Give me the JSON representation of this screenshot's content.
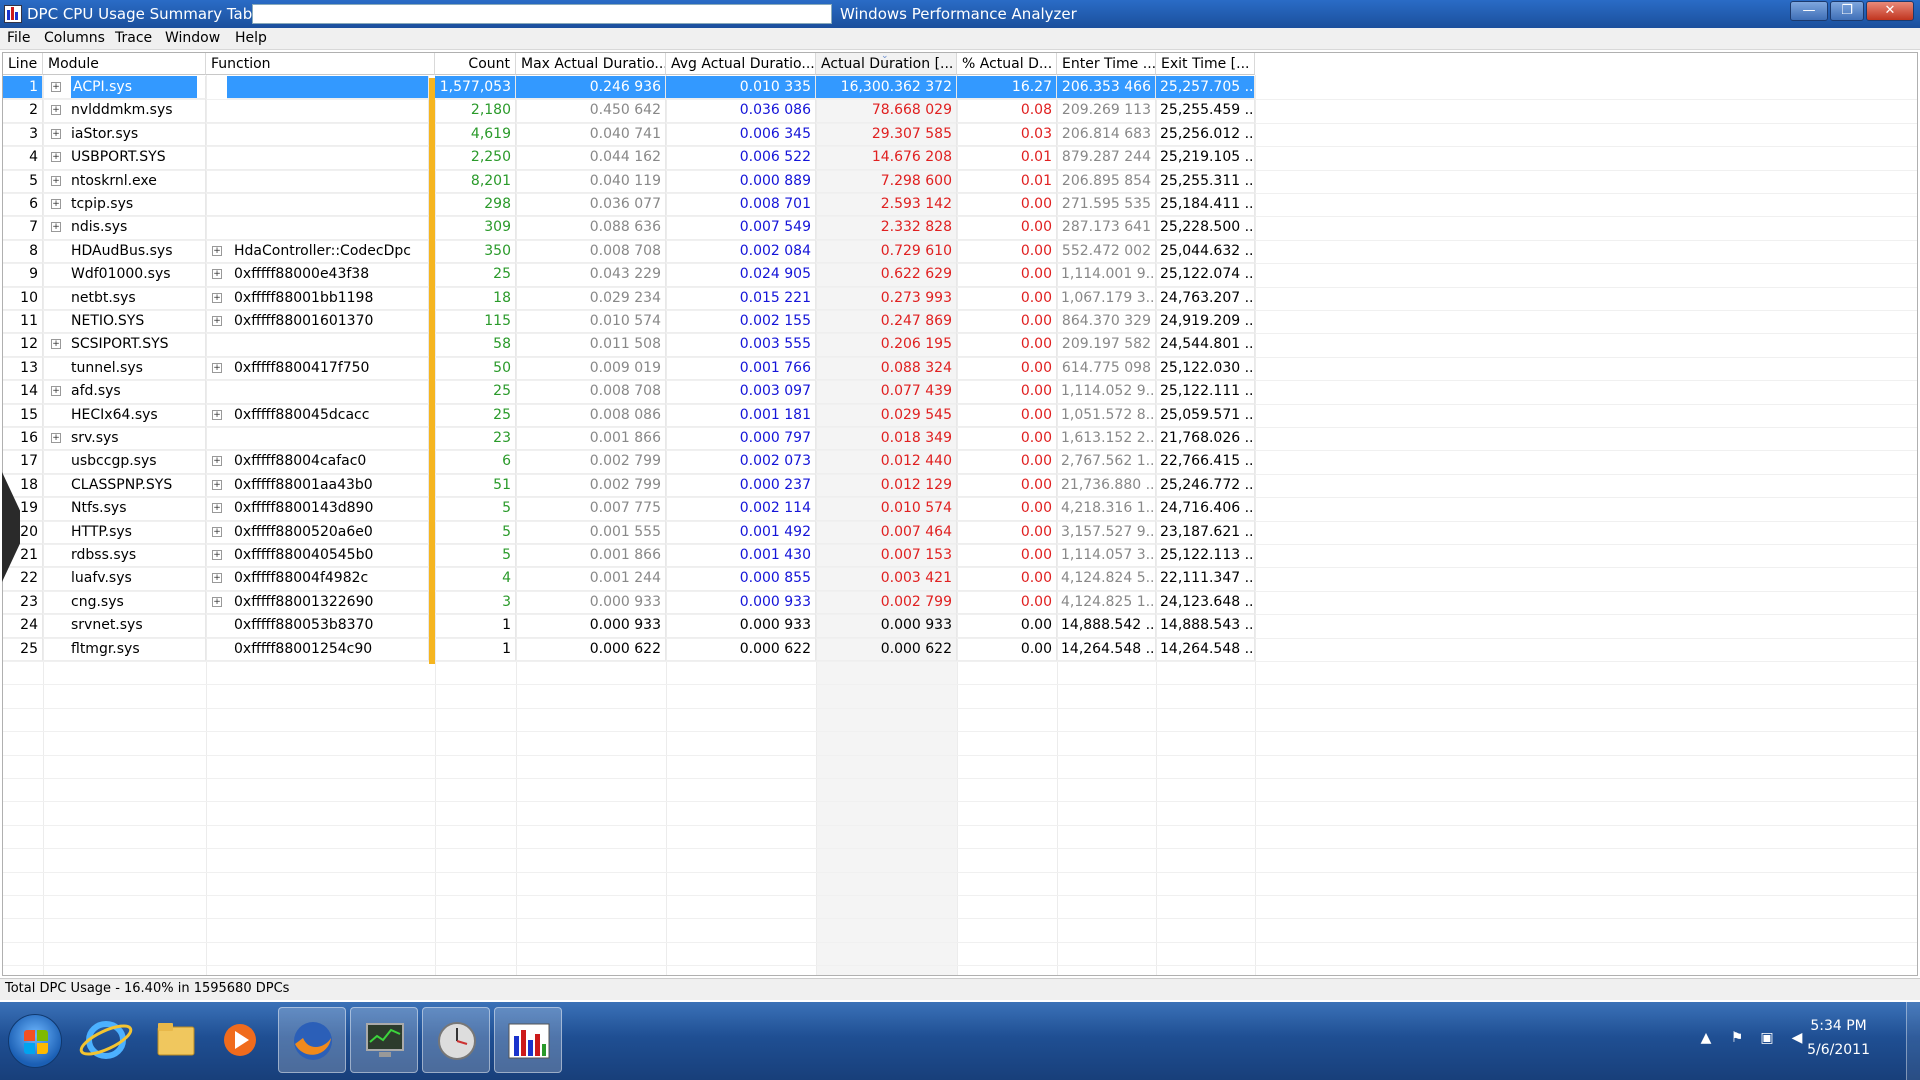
{
  "window": {
    "title": "DPC CPU Usage Summary Table -",
    "app_name": "Windows Performance Analyzer",
    "controls": {
      "minimize": "—",
      "maximize": "❐",
      "close": "✕"
    }
  },
  "menu": [
    "File",
    "Columns",
    "Trace",
    "Window",
    "Help"
  ],
  "columns": {
    "line": "Line",
    "module": "Module",
    "function": "Function",
    "count": "Count",
    "max_dur": "Max Actual Duratio...",
    "avg_dur": "Avg Actual Duratio...",
    "act_dur": "Actual Duration [...",
    "pct": "% Actual D...",
    "enter": "Enter Time ...",
    "exit": "Exit Time [..."
  },
  "rows": [
    {
      "line": "1",
      "module": "ACPI.sys",
      "function": "",
      "count": "1,577,053",
      "max": "0.246 936",
      "avg": "0.010 335",
      "act": "16,300.362 372",
      "pct": "16.27",
      "enter": "206.353 466",
      "exit": "25,257.705 ...",
      "expand": "module",
      "selected": true
    },
    {
      "line": "2",
      "module": "nvlddmkm.sys",
      "function": "",
      "count": "2,180",
      "max": "0.450 642",
      "avg": "0.036 086",
      "act": "78.668 029",
      "pct": "0.08",
      "enter": "209.269 113",
      "exit": "25,255.459 ...",
      "expand": "module"
    },
    {
      "line": "3",
      "module": "iaStor.sys",
      "function": "",
      "count": "4,619",
      "max": "0.040 741",
      "avg": "0.006 345",
      "act": "29.307 585",
      "pct": "0.03",
      "enter": "206.814 683",
      "exit": "25,256.012 ...",
      "expand": "module"
    },
    {
      "line": "4",
      "module": "USBPORT.SYS",
      "function": "",
      "count": "2,250",
      "max": "0.044 162",
      "avg": "0.006 522",
      "act": "14.676 208",
      "pct": "0.01",
      "enter": "879.287 244",
      "exit": "25,219.105 ...",
      "expand": "module"
    },
    {
      "line": "5",
      "module": "ntoskrnl.exe",
      "function": "",
      "count": "8,201",
      "max": "0.040 119",
      "avg": "0.000 889",
      "act": "7.298 600",
      "pct": "0.01",
      "enter": "206.895 854",
      "exit": "25,255.311 ...",
      "expand": "module"
    },
    {
      "line": "6",
      "module": "tcpip.sys",
      "function": "",
      "count": "298",
      "max": "0.036 077",
      "avg": "0.008 701",
      "act": "2.593 142",
      "pct": "0.00",
      "enter": "271.595 535",
      "exit": "25,184.411 ...",
      "expand": "module"
    },
    {
      "line": "7",
      "module": "ndis.sys",
      "function": "",
      "count": "309",
      "max": "0.088 636",
      "avg": "0.007 549",
      "act": "2.332 828",
      "pct": "0.00",
      "enter": "287.173 641",
      "exit": "25,228.500 ...",
      "expand": "module"
    },
    {
      "line": "8",
      "module": "HDAudBus.sys",
      "function": "HdaController::CodecDpc",
      "count": "350",
      "max": "0.008 708",
      "avg": "0.002 084",
      "act": "0.729 610",
      "pct": "0.00",
      "enter": "552.472 002",
      "exit": "25,044.632 ...",
      "expand": "function"
    },
    {
      "line": "9",
      "module": "Wdf01000.sys",
      "function": "0xfffff88000e43f38",
      "count": "25",
      "max": "0.043 229",
      "avg": "0.024 905",
      "act": "0.622 629",
      "pct": "0.00",
      "enter": "1,114.001 9...",
      "exit": "25,122.074 ...",
      "expand": "function"
    },
    {
      "line": "10",
      "module": "netbt.sys",
      "function": "0xfffff88001bb1198",
      "count": "18",
      "max": "0.029 234",
      "avg": "0.015 221",
      "act": "0.273 993",
      "pct": "0.00",
      "enter": "1,067.179 3...",
      "exit": "24,763.207 ...",
      "expand": "function"
    },
    {
      "line": "11",
      "module": "NETIO.SYS",
      "function": "0xfffff88001601370",
      "count": "115",
      "max": "0.010 574",
      "avg": "0.002 155",
      "act": "0.247 869",
      "pct": "0.00",
      "enter": "864.370 329",
      "exit": "24,919.209 ...",
      "expand": "function"
    },
    {
      "line": "12",
      "module": "SCSIPORT.SYS",
      "function": "",
      "count": "58",
      "max": "0.011 508",
      "avg": "0.003 555",
      "act": "0.206 195",
      "pct": "0.00",
      "enter": "209.197 582",
      "exit": "24,544.801 ...",
      "expand": "module"
    },
    {
      "line": "13",
      "module": "tunnel.sys",
      "function": "0xfffff8800417f750",
      "count": "50",
      "max": "0.009 019",
      "avg": "0.001 766",
      "act": "0.088 324",
      "pct": "0.00",
      "enter": "614.775 098",
      "exit": "25,122.030 ...",
      "expand": "function"
    },
    {
      "line": "14",
      "module": "afd.sys",
      "function": "",
      "count": "25",
      "max": "0.008 708",
      "avg": "0.003 097",
      "act": "0.077 439",
      "pct": "0.00",
      "enter": "1,114.052 9...",
      "exit": "25,122.111 ...",
      "expand": "module"
    },
    {
      "line": "15",
      "module": "HECIx64.sys",
      "function": "0xfffff880045dcacc",
      "count": "25",
      "max": "0.008 086",
      "avg": "0.001 181",
      "act": "0.029 545",
      "pct": "0.00",
      "enter": "1,051.572 8...",
      "exit": "25,059.571 ...",
      "expand": "function"
    },
    {
      "line": "16",
      "module": "srv.sys",
      "function": "",
      "count": "23",
      "max": "0.001 866",
      "avg": "0.000 797",
      "act": "0.018 349",
      "pct": "0.00",
      "enter": "1,613.152 2...",
      "exit": "21,768.026 ...",
      "expand": "module"
    },
    {
      "line": "17",
      "module": "usbccgp.sys",
      "function": "0xfffff88004cafac0",
      "count": "6",
      "max": "0.002 799",
      "avg": "0.002 073",
      "act": "0.012 440",
      "pct": "0.00",
      "enter": "2,767.562 1...",
      "exit": "22,766.415 ...",
      "expand": "function"
    },
    {
      "line": "18",
      "module": "CLASSPNP.SYS",
      "function": "0xfffff88001aa43b0",
      "count": "51",
      "max": "0.002 799",
      "avg": "0.000 237",
      "act": "0.012 129",
      "pct": "0.00",
      "enter": "21,736.880 ...",
      "exit": "25,246.772 ...",
      "expand": "function"
    },
    {
      "line": "19",
      "module": "Ntfs.sys",
      "function": "0xfffff8800143d890",
      "count": "5",
      "max": "0.007 775",
      "avg": "0.002 114",
      "act": "0.010 574",
      "pct": "0.00",
      "enter": "4,218.316 1...",
      "exit": "24,716.406 ...",
      "expand": "function"
    },
    {
      "line": "20",
      "module": "HTTP.sys",
      "function": "0xfffff8800520a6e0",
      "count": "5",
      "max": "0.001 555",
      "avg": "0.001 492",
      "act": "0.007 464",
      "pct": "0.00",
      "enter": "3,157.527 9...",
      "exit": "23,187.621 ...",
      "expand": "function"
    },
    {
      "line": "21",
      "module": "rdbss.sys",
      "function": "0xfffff880040545b0",
      "count": "5",
      "max": "0.001 866",
      "avg": "0.001 430",
      "act": "0.007 153",
      "pct": "0.00",
      "enter": "1,114.057 3...",
      "exit": "25,122.113 ...",
      "expand": "function"
    },
    {
      "line": "22",
      "module": "luafv.sys",
      "function": "0xfffff88004f4982c",
      "count": "4",
      "max": "0.001 244",
      "avg": "0.000 855",
      "act": "0.003 421",
      "pct": "0.00",
      "enter": "4,124.824 5...",
      "exit": "22,111.347 ...",
      "expand": "function"
    },
    {
      "line": "23",
      "module": "cng.sys",
      "function": "0xfffff88001322690",
      "count": "3",
      "max": "0.000 933",
      "avg": "0.000 933",
      "act": "0.002 799",
      "pct": "0.00",
      "enter": "4,124.825 1...",
      "exit": "24,123.648 ...",
      "expand": "function"
    },
    {
      "line": "24",
      "module": "srvnet.sys",
      "function": "0xfffff880053b8370",
      "count": "1",
      "max": "0.000 933",
      "avg": "0.000 933",
      "act": "0.000 933",
      "pct": "0.00",
      "enter": "14,888.542 ...",
      "exit": "14,888.543 ...",
      "expand": "none",
      "plain": true
    },
    {
      "line": "25",
      "module": "fltmgr.sys",
      "function": "0xfffff88001254c90",
      "count": "1",
      "max": "0.000 622",
      "avg": "0.000 622",
      "act": "0.000 622",
      "pct": "0.00",
      "enter": "14,264.548 ...",
      "exit": "14,264.548 ...",
      "expand": "none",
      "plain": true
    }
  ],
  "status": "Total DPC Usage - 16.40% in 1595680 DPCs",
  "taskbar": {
    "icons": [
      "start-orb-icon",
      "internet-explorer-icon",
      "folder-icon",
      "media-player-icon",
      "firefox-icon",
      "monitor-icon",
      "clock-tool-icon",
      "performance-analyzer-icon"
    ],
    "time": "5:34 PM",
    "date": "5/6/2011"
  },
  "colors": {
    "count": "#2a9a2a",
    "avg": "#1414d8",
    "actual": "#e02020",
    "selection": "#3399ff",
    "accent": "#f5b520"
  }
}
